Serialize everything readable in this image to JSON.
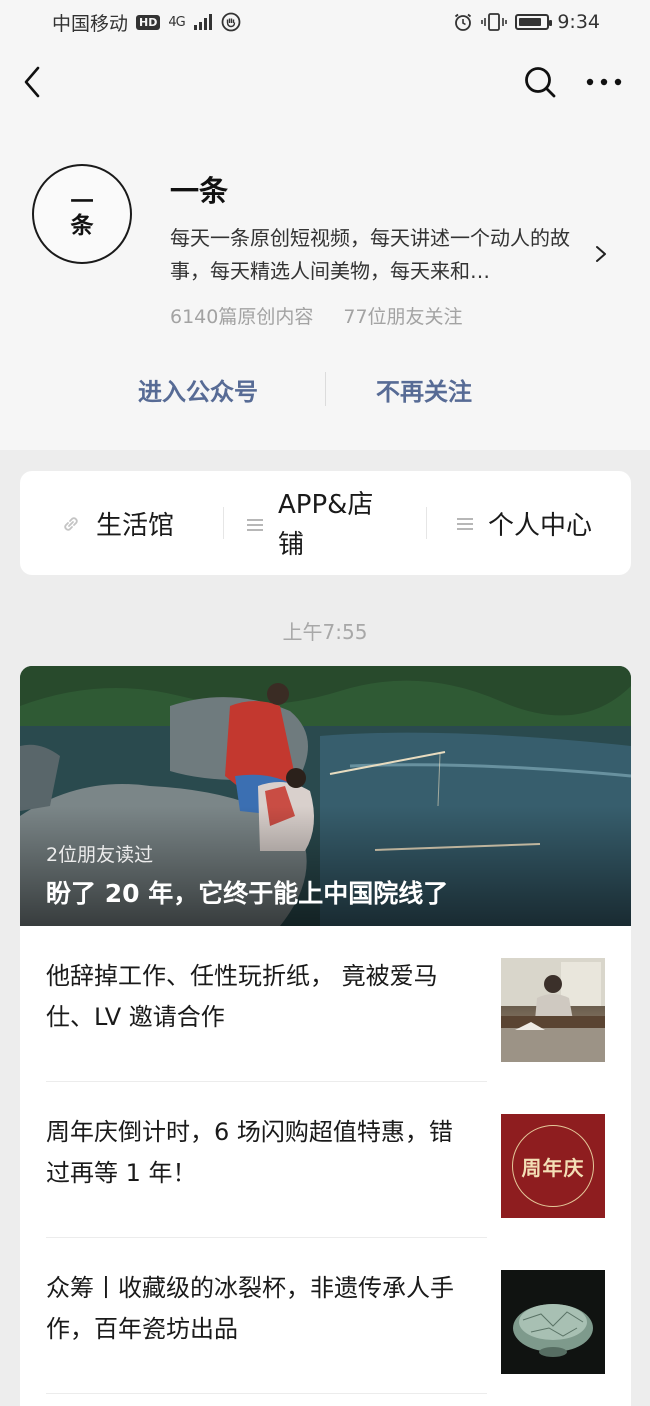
{
  "status_bar": {
    "carrier": "中国移动",
    "hd": "HD",
    "network": "4G",
    "time": "9:34",
    "battery_level": 0.85,
    "icons": [
      "hd-icon",
      "signal-icon",
      "privacy-icon",
      "alarm-icon",
      "vibrate-icon",
      "battery-icon"
    ]
  },
  "nav": {
    "icons": [
      "back-icon",
      "search-icon",
      "more-icon"
    ]
  },
  "profile": {
    "avatar_line1": "一",
    "avatar_line2": "条",
    "name": "一条",
    "description": "每天一条原创短视频，每天讲述一个动人的故事，每天精选人间美物，每天来和…",
    "original_count": "6140篇原创内容",
    "friends_follow": "77位朋友关注",
    "enter_label": "进入公众号",
    "unfollow_label": "不再关注"
  },
  "menu": {
    "items": [
      {
        "label": "生活馆",
        "icon": "link-icon"
      },
      {
        "label": "APP&店铺",
        "icon": "list-icon"
      },
      {
        "label": "个人中心",
        "icon": "list-icon"
      }
    ]
  },
  "feed": {
    "time": "上午7:55",
    "hero": {
      "meta": "2位朋友读过",
      "title": "盼了 20 年，它终于能上中国院线了"
    },
    "articles": [
      {
        "title": "他辞掉工作、任性玩折纸， 竟被爱马仕、LV 邀请合作"
      },
      {
        "title": "周年庆倒计时，6 场闪购超值特惠，错过再等 1 年！",
        "thumb_text": "周年庆"
      },
      {
        "title": "众筹丨收藏级的冰裂杯，非遗传承人手作，百年瓷坊出品"
      }
    ]
  },
  "colors": {
    "link": "#576b95",
    "background": "#ededed",
    "header_bg": "#f6f6f6",
    "anniversary_red": "#8e1d1f"
  }
}
